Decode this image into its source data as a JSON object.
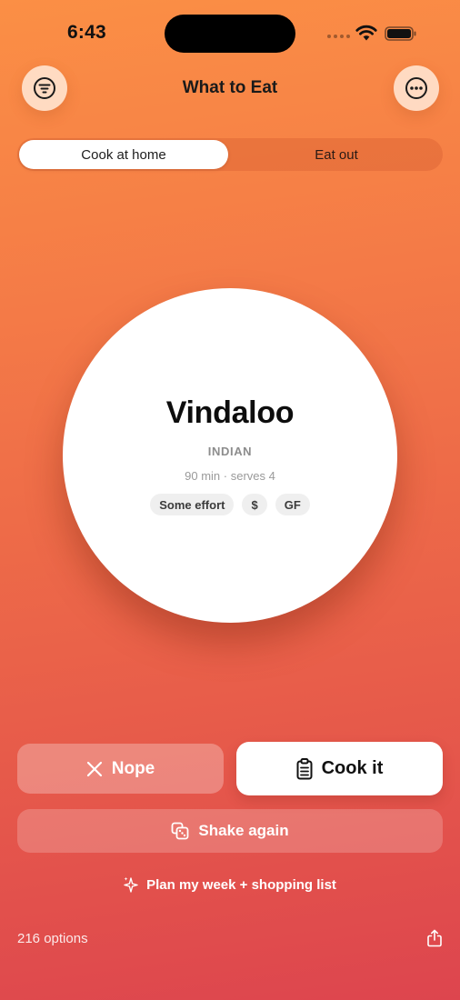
{
  "status_bar": {
    "time": "6:43"
  },
  "header": {
    "title": "What to Eat"
  },
  "segmented_control": {
    "options": [
      "Cook at home",
      "Eat out"
    ],
    "selected": "Cook at home"
  },
  "dish": {
    "name": "Vindaloo",
    "cuisine": "INDIAN",
    "meta": "90 min · serves 4",
    "tags": [
      "Some effort",
      "$",
      "GF"
    ]
  },
  "actions": {
    "nope_label": "Nope",
    "cook_label": "Cook it",
    "shake_label": "Shake again",
    "plan_label": "Plan my week + shopping list"
  },
  "footer": {
    "options_count": "216 options"
  },
  "icons": {
    "filter": "filter-icon",
    "more": "more-icon",
    "nope": "close-icon",
    "cook": "clipboard-icon",
    "shake": "dice-icon",
    "plan": "sparkle-icon",
    "share": "share-icon"
  },
  "colors": {
    "gradient_top": "#fb8f45",
    "gradient_bottom": "#dd454e",
    "card": "#ffffff",
    "tag_bg": "#efefef"
  }
}
